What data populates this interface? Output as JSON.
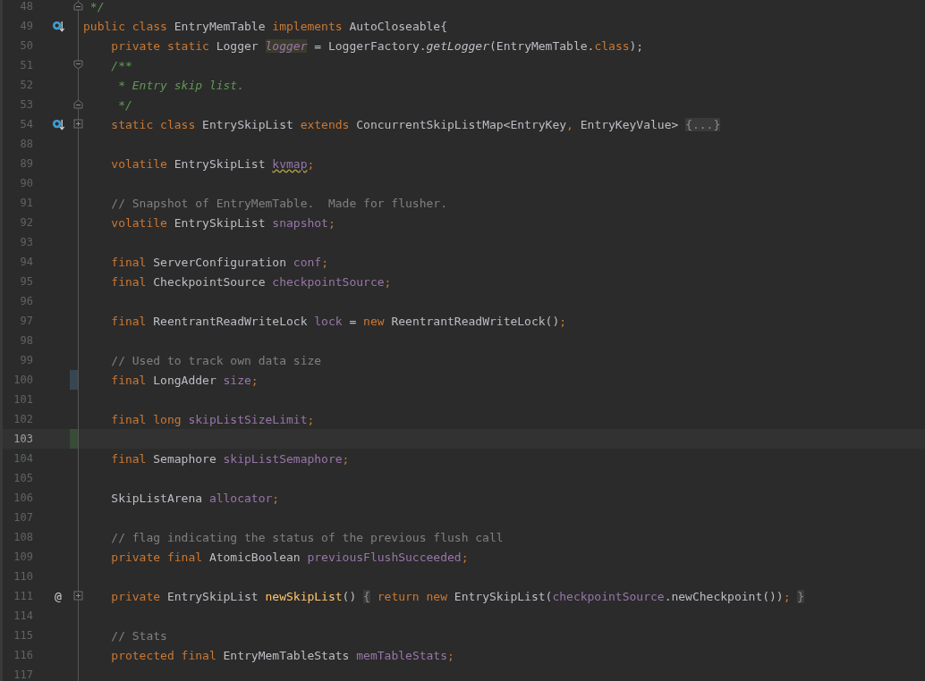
{
  "editor": {
    "lines": [
      {
        "number": "48",
        "current": false,
        "fold_marker": {
          "kind": "end"
        },
        "tokens": [
          {
            "kind": "doc",
            "text": " */"
          }
        ]
      },
      {
        "number": "49",
        "current": false,
        "gutter_icon": {
          "kind": "implemented"
        },
        "tokens": [
          {
            "kind": "keyword",
            "text": "public class"
          },
          {
            "kind": "plain",
            "text": " EntryMemTable "
          },
          {
            "kind": "keyword",
            "text": "implements"
          },
          {
            "kind": "plain",
            "text": " AutoCloseable{"
          }
        ]
      },
      {
        "number": "50",
        "current": false,
        "tokens": [
          {
            "kind": "keyword",
            "text": "    private static"
          },
          {
            "kind": "plain",
            "text": " Logger "
          },
          {
            "kind": "field-highlight",
            "text": "logger"
          },
          {
            "kind": "plain",
            "text": " = LoggerFactory."
          },
          {
            "kind": "static-method",
            "text": "getLogger"
          },
          {
            "kind": "plain",
            "text": "(EntryMemTable."
          },
          {
            "kind": "keyword",
            "text": "class"
          },
          {
            "kind": "plain",
            "text": ");"
          }
        ]
      },
      {
        "number": "51",
        "current": false,
        "fold_marker": {
          "kind": "start"
        },
        "tokens": [
          {
            "kind": "doc",
            "text": "    /**"
          }
        ]
      },
      {
        "number": "52",
        "current": false,
        "tokens": [
          {
            "kind": "doc",
            "text": "     * Entry skip list."
          }
        ]
      },
      {
        "number": "53",
        "current": false,
        "fold_marker": {
          "kind": "end"
        },
        "tokens": [
          {
            "kind": "doc",
            "text": "     */"
          }
        ]
      },
      {
        "number": "54",
        "current": false,
        "gutter_icon": {
          "kind": "implemented"
        },
        "fold_marker": {
          "kind": "collapsed"
        },
        "tokens": [
          {
            "kind": "keyword",
            "text": "    static class"
          },
          {
            "kind": "plain",
            "text": " EntrySkipList "
          },
          {
            "kind": "keyword",
            "text": "extends"
          },
          {
            "kind": "plain",
            "text": " ConcurrentSkipListMap<EntryKey"
          },
          {
            "kind": "keyword",
            "text": ","
          },
          {
            "kind": "plain",
            "text": " EntryKeyValue> "
          },
          {
            "kind": "folded",
            "text": "{...}"
          }
        ]
      },
      {
        "number": "88",
        "current": false
      },
      {
        "number": "89",
        "current": false,
        "tokens": [
          {
            "kind": "keyword",
            "text": "    volatile"
          },
          {
            "kind": "plain",
            "text": " EntrySkipList "
          },
          {
            "kind": "field-warning",
            "text": "kvmap"
          },
          {
            "kind": "keyword",
            "text": ";"
          }
        ]
      },
      {
        "number": "90",
        "current": false
      },
      {
        "number": "91",
        "current": false,
        "tokens": [
          {
            "kind": "comment",
            "text": "    // Snapshot of EntryMemTable.  Made for flusher."
          }
        ]
      },
      {
        "number": "92",
        "current": false,
        "tokens": [
          {
            "kind": "keyword",
            "text": "    volatile"
          },
          {
            "kind": "plain",
            "text": " EntrySkipList "
          },
          {
            "kind": "field",
            "text": "snapshot"
          },
          {
            "kind": "keyword",
            "text": ";"
          }
        ]
      },
      {
        "number": "93",
        "current": false
      },
      {
        "number": "94",
        "current": false,
        "tokens": [
          {
            "kind": "keyword",
            "text": "    final"
          },
          {
            "kind": "plain",
            "text": " ServerConfiguration "
          },
          {
            "kind": "field",
            "text": "conf"
          },
          {
            "kind": "keyword",
            "text": ";"
          }
        ]
      },
      {
        "number": "95",
        "current": false,
        "tokens": [
          {
            "kind": "keyword",
            "text": "    final"
          },
          {
            "kind": "plain",
            "text": " CheckpointSource "
          },
          {
            "kind": "field",
            "text": "checkpointSource"
          },
          {
            "kind": "keyword",
            "text": ";"
          }
        ]
      },
      {
        "number": "96",
        "current": false
      },
      {
        "number": "97",
        "current": false,
        "tokens": [
          {
            "kind": "keyword",
            "text": "    final"
          },
          {
            "kind": "plain",
            "text": " ReentrantReadWriteLock "
          },
          {
            "kind": "field",
            "text": "lock"
          },
          {
            "kind": "plain",
            "text": " = "
          },
          {
            "kind": "keyword",
            "text": "new"
          },
          {
            "kind": "plain",
            "text": " ReentrantReadWriteLock()"
          },
          {
            "kind": "keyword",
            "text": ";"
          }
        ]
      },
      {
        "number": "98",
        "current": false
      },
      {
        "number": "99",
        "current": false,
        "tokens": [
          {
            "kind": "comment",
            "text": "    // Used to track own data size"
          }
        ]
      },
      {
        "number": "100",
        "current": false,
        "change_marker": {
          "kind": "modified"
        },
        "tokens": [
          {
            "kind": "keyword",
            "text": "    final"
          },
          {
            "kind": "plain",
            "text": " LongAdder "
          },
          {
            "kind": "field",
            "text": "size"
          },
          {
            "kind": "keyword",
            "text": ";"
          }
        ]
      },
      {
        "number": "101",
        "current": false
      },
      {
        "number": "102",
        "current": false,
        "tokens": [
          {
            "kind": "keyword",
            "text": "    final long "
          },
          {
            "kind": "field",
            "text": "skipListSizeLimit"
          },
          {
            "kind": "keyword",
            "text": ";"
          }
        ]
      },
      {
        "number": "103",
        "current": true,
        "change_marker": {
          "kind": "added"
        }
      },
      {
        "number": "104",
        "current": false,
        "tokens": [
          {
            "kind": "keyword",
            "text": "    final"
          },
          {
            "kind": "plain",
            "text": " Semaphore "
          },
          {
            "kind": "field",
            "text": "skipListSemaphore"
          },
          {
            "kind": "keyword",
            "text": ";"
          }
        ]
      },
      {
        "number": "105",
        "current": false
      },
      {
        "number": "106",
        "current": false,
        "tokens": [
          {
            "kind": "plain",
            "text": "    SkipListArena "
          },
          {
            "kind": "field",
            "text": "allocator"
          },
          {
            "kind": "keyword",
            "text": ";"
          }
        ]
      },
      {
        "number": "107",
        "current": false
      },
      {
        "number": "108",
        "current": false,
        "tokens": [
          {
            "kind": "comment",
            "text": "    // flag indicating the status of the previous flush call"
          }
        ]
      },
      {
        "number": "109",
        "current": false,
        "tokens": [
          {
            "kind": "keyword",
            "text": "    private final"
          },
          {
            "kind": "plain",
            "text": " AtomicBoolean "
          },
          {
            "kind": "field",
            "text": "previousFlushSucceeded"
          },
          {
            "kind": "keyword",
            "text": ";"
          }
        ]
      },
      {
        "number": "110",
        "current": false
      },
      {
        "number": "111",
        "current": false,
        "gutter_text": "@",
        "fold_marker": {
          "kind": "collapsed"
        },
        "tokens": [
          {
            "kind": "keyword",
            "text": "    private"
          },
          {
            "kind": "plain",
            "text": " EntrySkipList "
          },
          {
            "kind": "method",
            "text": "newSkipList"
          },
          {
            "kind": "plain",
            "text": "() "
          },
          {
            "kind": "folded-brace",
            "text": "{"
          },
          {
            "kind": "keyword",
            "text": " return new"
          },
          {
            "kind": "plain",
            "text": " EntrySkipList("
          },
          {
            "kind": "field",
            "text": "checkpointSource"
          },
          {
            "kind": "plain",
            "text": ".newCheckpoint())"
          },
          {
            "kind": "keyword",
            "text": "; "
          },
          {
            "kind": "folded-brace",
            "text": "}"
          }
        ]
      },
      {
        "number": "114",
        "current": false
      },
      {
        "number": "115",
        "current": false,
        "tokens": [
          {
            "kind": "comment",
            "text": "    // Stats"
          }
        ]
      },
      {
        "number": "116",
        "current": false,
        "tokens": [
          {
            "kind": "keyword",
            "text": "    protected final"
          },
          {
            "kind": "plain",
            "text": " EntryMemTableStats "
          },
          {
            "kind": "field",
            "text": "memTableStats"
          },
          {
            "kind": "keyword",
            "text": ";"
          }
        ]
      },
      {
        "number": "117",
        "current": false
      }
    ]
  }
}
